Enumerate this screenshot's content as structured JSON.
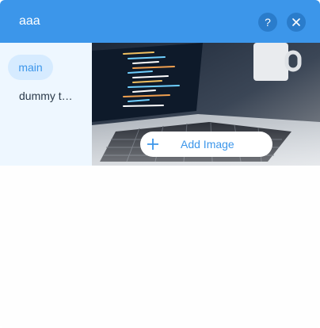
{
  "header": {
    "title": "aaa",
    "help_label": "?",
    "help_icon": "help-icon",
    "close_icon": "close-icon",
    "color": "#3c96ea"
  },
  "sidebar": {
    "items": [
      {
        "label": "main",
        "active": true
      },
      {
        "label": "dummy t…",
        "active": false
      }
    ]
  },
  "preview": {
    "image": "laptop-with-code-photo",
    "add_button_label": "Add Image",
    "add_icon": "plus-icon"
  },
  "colors": {
    "accent": "#3c96ea",
    "sidebar_bg": "#eef7ff",
    "active_item_bg": "#d6ebff"
  }
}
